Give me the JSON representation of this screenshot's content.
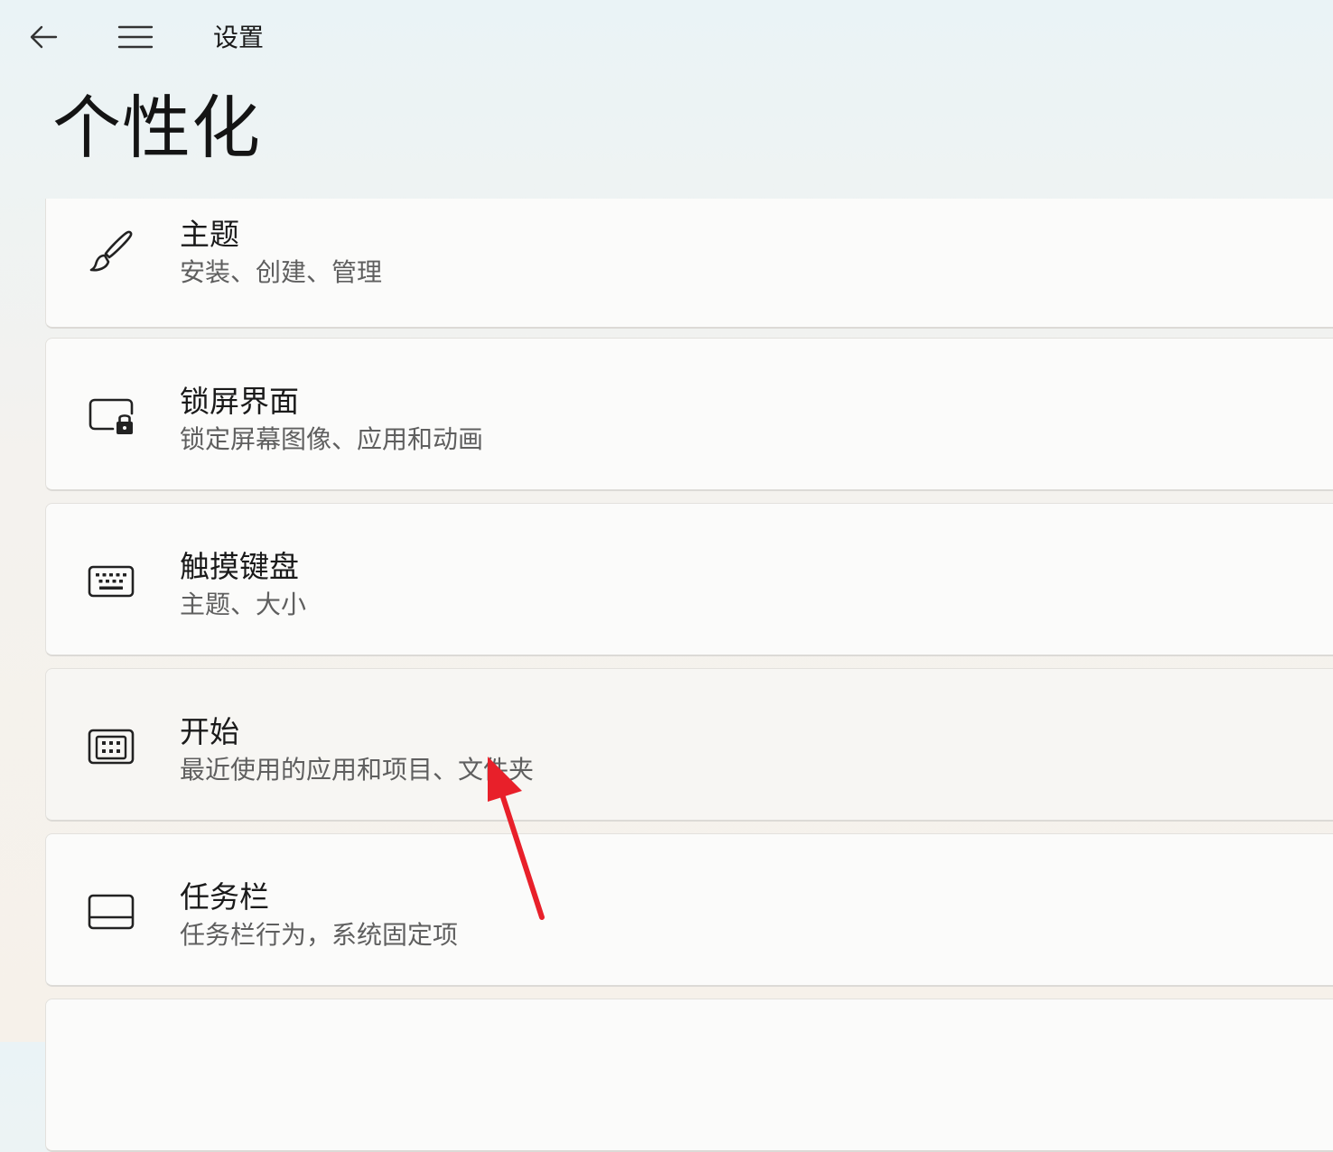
{
  "app": {
    "title": "设置",
    "back_icon": "arrow-left-icon",
    "menu_icon": "hamburger-menu-icon"
  },
  "page": {
    "title": "个性化"
  },
  "items": [
    {
      "title": "主题",
      "subtitle": "安装、创建、管理",
      "icon": "brush-icon"
    },
    {
      "title": "锁屏界面",
      "subtitle": "锁定屏幕图像、应用和动画",
      "icon": "lock-screen-icon"
    },
    {
      "title": "触摸键盘",
      "subtitle": "主题、大小",
      "icon": "keyboard-icon"
    },
    {
      "title": "开始",
      "subtitle": "最近使用的应用和项目、文件夹",
      "icon": "start-icon"
    },
    {
      "title": "任务栏",
      "subtitle": "任务栏行为，系统固定项",
      "icon": "taskbar-icon"
    },
    {
      "title": "",
      "subtitle": "",
      "icon": ""
    }
  ],
  "annotation": {
    "arrow_color": "#e8202a",
    "icon": "red-arrow-icon"
  }
}
